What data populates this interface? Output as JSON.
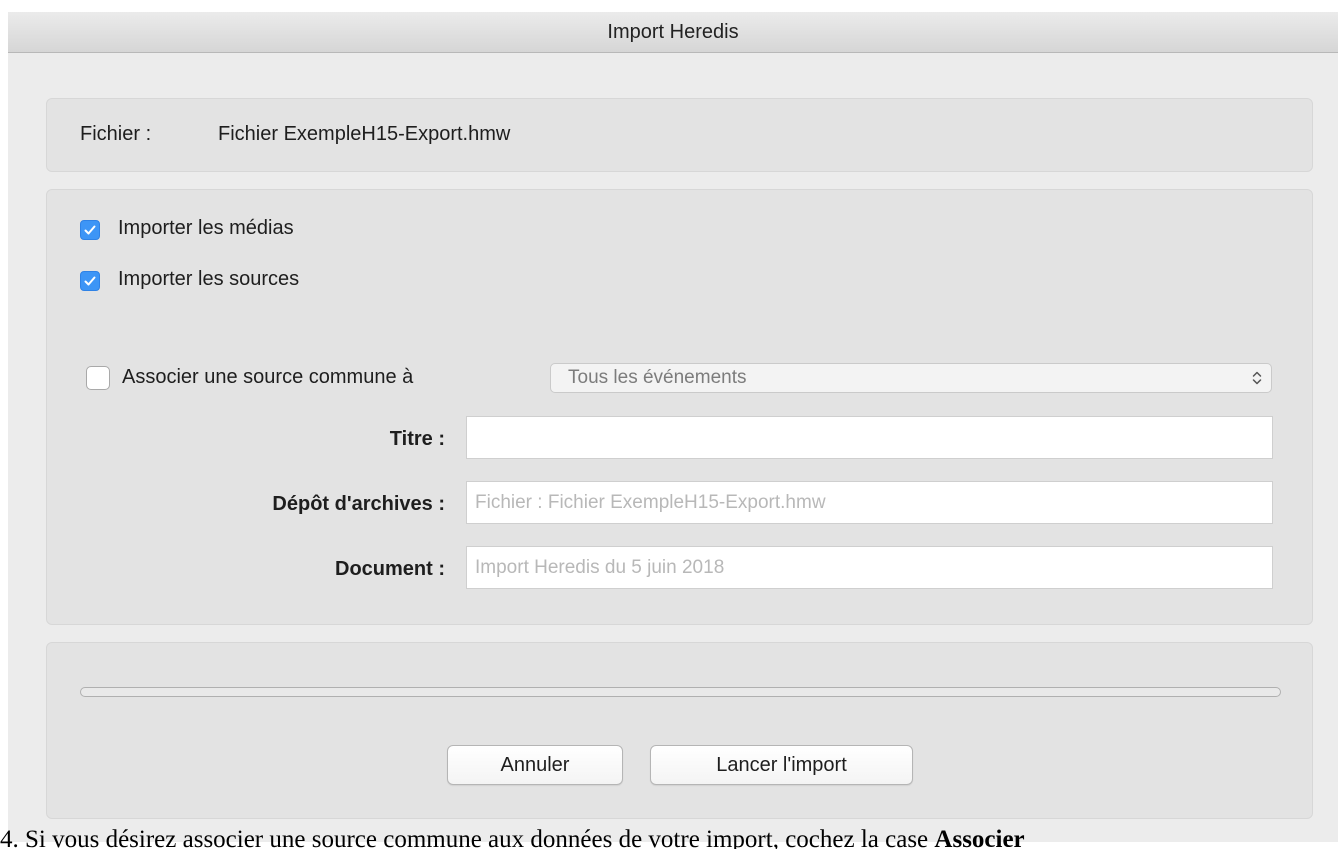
{
  "window": {
    "title": "Import Heredis"
  },
  "file": {
    "label": "Fichier :",
    "name": "Fichier ExempleH15-Export.hmw"
  },
  "options": {
    "import_media": {
      "label": "Importer les médias",
      "checked": true
    },
    "import_sources": {
      "label": "Importer les sources",
      "checked": true
    },
    "common_source": {
      "label": "Associer une source commune à",
      "checked": false
    },
    "events_select": {
      "value": "Tous les événements"
    }
  },
  "fields": {
    "title": {
      "label": "Titre :",
      "value": "",
      "placeholder": ""
    },
    "archive": {
      "label": "Dépôt d'archives :",
      "value": "",
      "placeholder": "Fichier : Fichier ExempleH15-Export.hmw"
    },
    "document": {
      "label": "Document :",
      "value": "",
      "placeholder": "Import Heredis du 5 juin 2018"
    }
  },
  "progress": {
    "value": 0
  },
  "buttons": {
    "cancel": "Annuler",
    "start": "Lancer l'import"
  },
  "caption": {
    "prefix": "4. Si vous désirez associer une source commune aux données de votre import, cochez la case ",
    "bold": "Associer"
  },
  "colors": {
    "accent": "#3d95f6",
    "window_bg": "#ececec",
    "panel_bg": "#e3e3e3"
  }
}
